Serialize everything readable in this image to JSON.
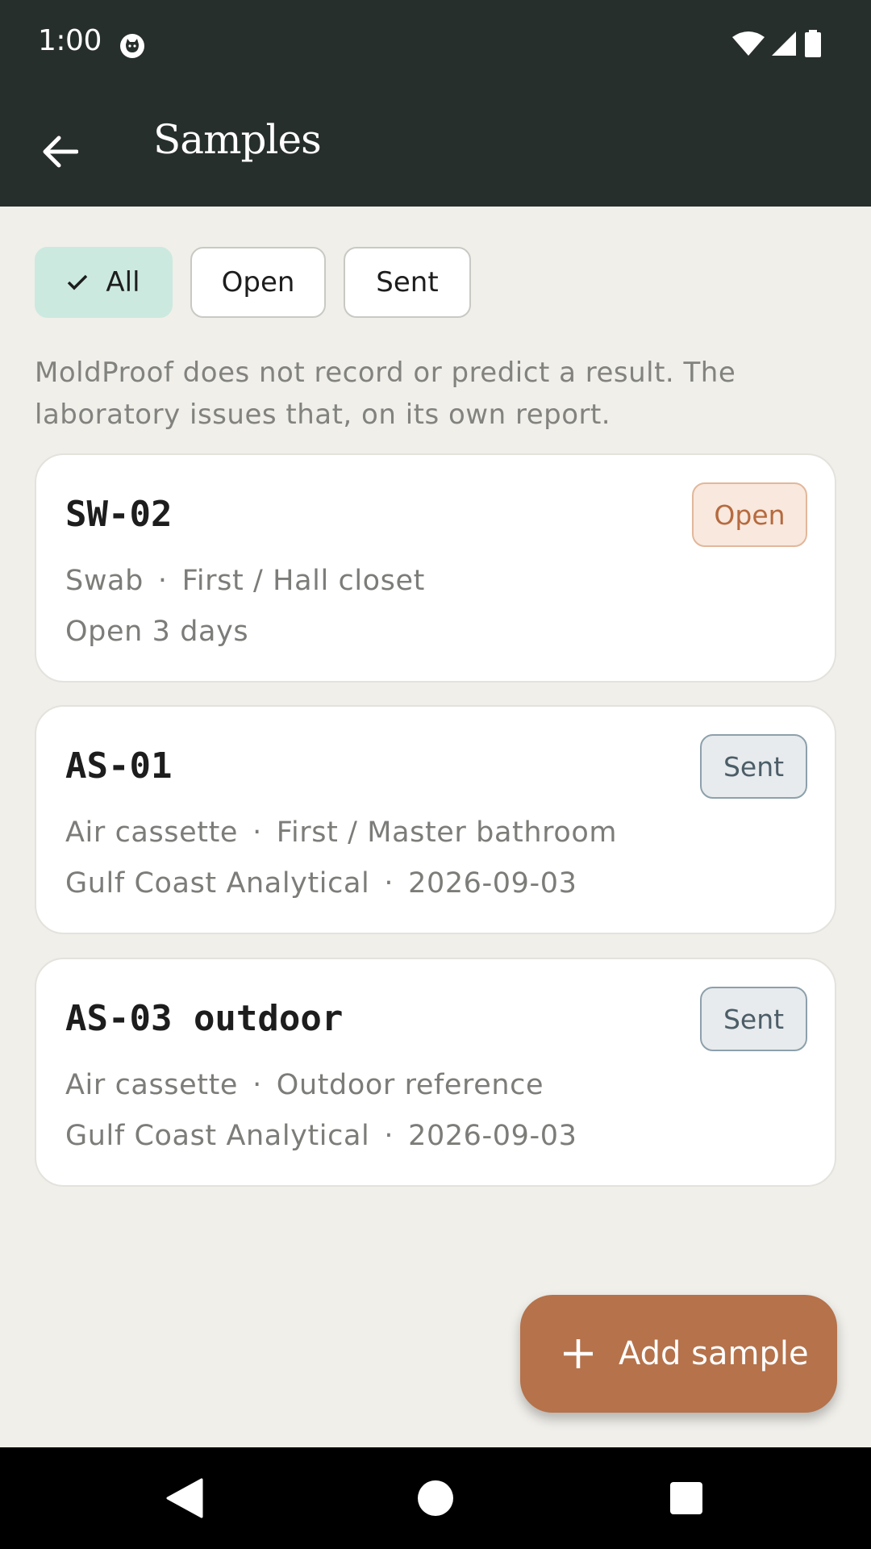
{
  "status_bar": {
    "time": "1:00"
  },
  "app_bar": {
    "title": "Samples"
  },
  "filters": [
    {
      "label": "All",
      "selected": true
    },
    {
      "label": "Open",
      "selected": false
    },
    {
      "label": "Sent",
      "selected": false
    }
  ],
  "disclaimer": "MoldProof does not record or predict a result. The laboratory issues that, on its own report.",
  "separator": "·",
  "samples": [
    {
      "id": "SW-02",
      "status": "Open",
      "type": "Swab",
      "location": "First / Hall closet",
      "detail": "Open 3 days"
    },
    {
      "id": "AS-01",
      "status": "Sent",
      "type": "Air cassette",
      "location": "First / Master bathroom",
      "lab": "Gulf Coast Analytical",
      "date": "2026-09-03"
    },
    {
      "id": "AS-03 outdoor",
      "status": "Sent",
      "type": "Air cassette",
      "location": "Outdoor reference",
      "lab": "Gulf Coast Analytical",
      "date": "2026-09-03"
    }
  ],
  "fab": {
    "label": "Add sample"
  },
  "colors": {
    "app_bar": "#272f2d",
    "background": "#f0efea",
    "accent": "#b5724b",
    "chip_selected": "#cce9df"
  }
}
